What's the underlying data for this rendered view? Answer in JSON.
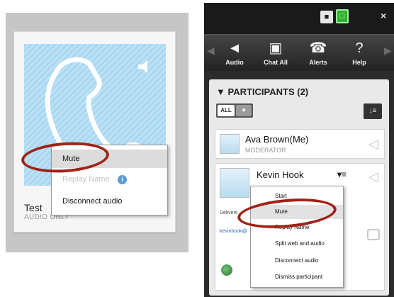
{
  "left": {
    "participant_name": "Test",
    "participant_sub": "AUDIO ONLY",
    "menu": {
      "mute": "Mute",
      "replay_name": "Replay Name",
      "disconnect": "Disconnect audio"
    }
  },
  "right": {
    "toolbar": {
      "audio": "Audio",
      "chat_all": "Chat All",
      "alerts": "Alerts",
      "help": "Help"
    },
    "participants_header": "PARTICIPANTS (2)",
    "filter_all": "ALL",
    "rows": [
      {
        "name": "Ava Brown(Me)",
        "role": "MODERATOR"
      },
      {
        "name": "Kevin Hook",
        "details_prefix": "Delivers",
        "email_prefix": "kevinhook@"
      }
    ],
    "menu": {
      "start": "Start",
      "mute": "Mute",
      "replay_name": "Replay Name",
      "split": "Split web and audio",
      "disconnect": "Disconnect audio",
      "dismiss": "Dismiss participant"
    }
  },
  "colors": {
    "highlight_oval": "#a12217",
    "tile_blue": "#a9d7f1",
    "dark_panel": "#2b2b2b",
    "unlock_green": "#2fb12f"
  }
}
